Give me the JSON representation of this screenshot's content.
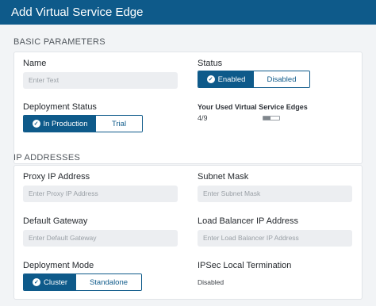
{
  "dialog": {
    "title": "Add Virtual Service Edge"
  },
  "basic": {
    "section_title": "BASIC PARAMETERS",
    "name_label": "Name",
    "name_placeholder": "Enter Text",
    "status_label": "Status",
    "status_options": [
      "Enabled",
      "Disabled"
    ],
    "status_selected": "Enabled",
    "deployment_status_label": "Deployment Status",
    "deployment_status_options": [
      "In Production",
      "Trial"
    ],
    "deployment_status_selected": "In Production",
    "used_edges_label": "Your Used Virtual Service Edges",
    "used_edges_value": "4/9",
    "used_edges_fraction": 0.444
  },
  "ip": {
    "section_title": "IP ADDRESSES",
    "proxy_label": "Proxy IP Address",
    "proxy_placeholder": "Enter Proxy IP Address",
    "subnet_label": "Subnet Mask",
    "subnet_placeholder": "Enter Subnet Mask",
    "gateway_label": "Default Gateway",
    "gateway_placeholder": "Enter Default Gateway",
    "lb_label": "Load Balancer IP Address",
    "lb_placeholder": "Enter Load Balancer IP Address",
    "mode_label": "Deployment Mode",
    "mode_options": [
      "Cluster",
      "Standalone"
    ],
    "mode_selected": "Cluster",
    "ipsec_label": "IPSec Local Termination",
    "ipsec_value": "Disabled"
  },
  "icons": {
    "selected": "check-circle-icon"
  },
  "colors": {
    "header": "#0e5a8a",
    "accent": "#0e5a8a",
    "background": "#f2f4f6"
  }
}
